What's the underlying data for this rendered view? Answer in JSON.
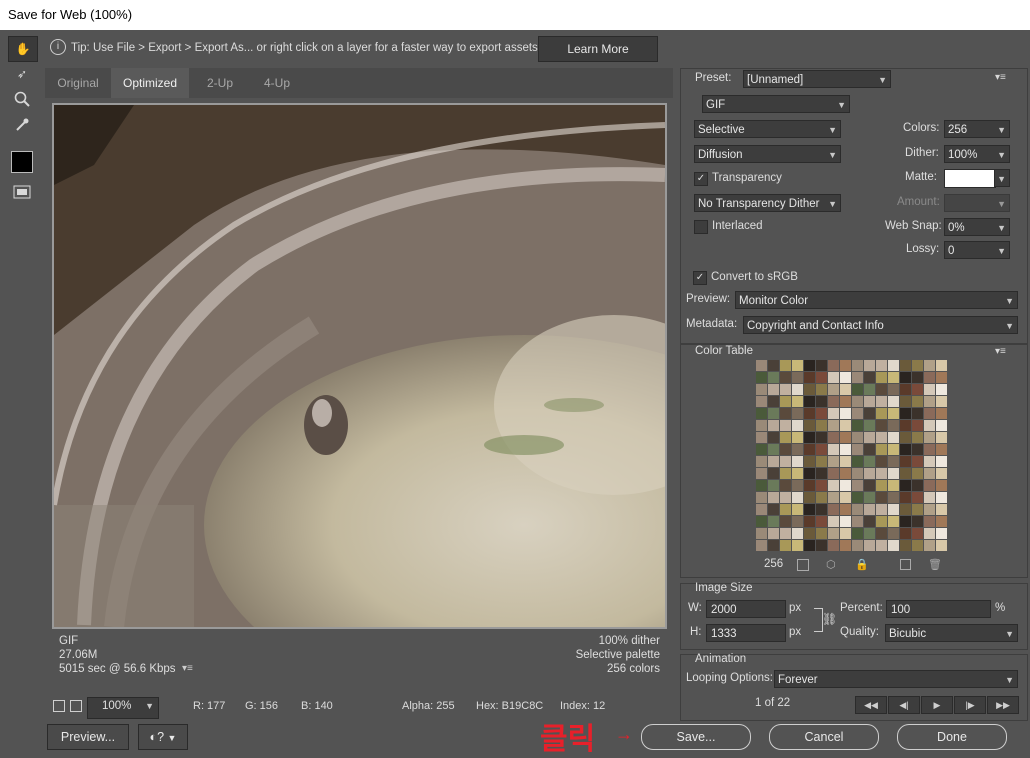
{
  "window": {
    "title": "Save for Web (100%)"
  },
  "tip": {
    "text": "Tip: Use File > Export > Export As...  or right click on a layer for a faster way to export assets",
    "learn_more": "Learn More"
  },
  "tabs": [
    "Original",
    "Optimized",
    "2-Up",
    "4-Up"
  ],
  "image_info": {
    "format": "GIF",
    "size": "27.06M",
    "time": "5015 sec @ 56.6 Kbps",
    "dither": "100% dither",
    "palette": "Selective palette",
    "colors": "256 colors"
  },
  "status": {
    "zoom": "100%",
    "r": "R: 177",
    "g": "G: 156",
    "b": "B: 140",
    "alpha": "Alpha: 255",
    "hex": "Hex: B19C8C",
    "index": "Index: 12"
  },
  "buttons": {
    "preview": "Preview...",
    "save": "Save...",
    "cancel": "Cancel",
    "done": "Done"
  },
  "annotation": {
    "text": "클릭",
    "color": "#e8202a"
  },
  "settings": {
    "preset_label": "Preset:",
    "preset_value": "[Unnamed]",
    "format": "GIF",
    "reduction": "Selective",
    "dither_algo": "Diffusion",
    "transparency_label": "Transparency",
    "transparency_checked": true,
    "transparency_dither": "No Transparency Dither",
    "interlaced_label": "Interlaced",
    "interlaced_checked": false,
    "colors_label": "Colors:",
    "colors_value": "256",
    "dither_label": "Dither:",
    "dither_value": "100%",
    "matte_label": "Matte:",
    "amount_label": "Amount:",
    "websnap_label": "Web Snap:",
    "websnap_value": "0%",
    "lossy_label": "Lossy:",
    "lossy_value": "0",
    "srgb_label": "Convert to sRGB",
    "srgb_checked": true,
    "preview_label": "Preview:",
    "preview_value": "Monitor Color",
    "metadata_label": "Metadata:",
    "metadata_value": "Copyright and Contact Info"
  },
  "color_table": {
    "title": "Color Table",
    "count": "256"
  },
  "image_size": {
    "title": "Image Size",
    "w_label": "W:",
    "w_value": "2000",
    "h_label": "H:",
    "h_value": "1333",
    "unit": "px",
    "percent_label": "Percent:",
    "percent_value": "100",
    "percent_unit": "%",
    "quality_label": "Quality:",
    "quality_value": "Bicubic"
  },
  "animation": {
    "title": "Animation",
    "looping_label": "Looping Options:",
    "looping_value": "Forever",
    "frame": "1 of 22"
  }
}
